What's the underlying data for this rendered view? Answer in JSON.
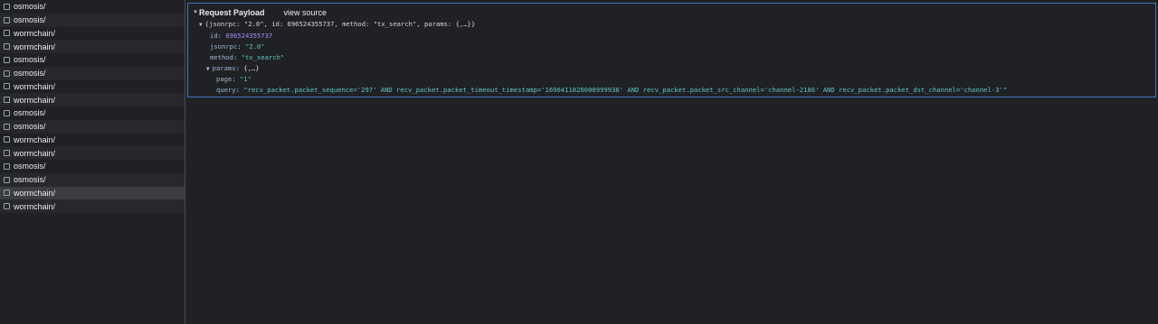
{
  "sidebar": {
    "items": [
      {
        "label": "osmosis/"
      },
      {
        "label": "osmosis/"
      },
      {
        "label": "wormchain/"
      },
      {
        "label": "wormchain/"
      },
      {
        "label": "osmosis/"
      },
      {
        "label": "osmosis/"
      },
      {
        "label": "wormchain/"
      },
      {
        "label": "wormchain/"
      },
      {
        "label": "osmosis/"
      },
      {
        "label": "osmosis/"
      },
      {
        "label": "wormchain/"
      },
      {
        "label": "wormchain/"
      },
      {
        "label": "osmosis/"
      },
      {
        "label": "osmosis/"
      },
      {
        "label": "wormchain/",
        "selected": true
      },
      {
        "label": "wormchain/"
      }
    ]
  },
  "payload": {
    "header": "Request Payload",
    "view_source": "view source",
    "summary": "{jsonrpc: \"2.0\", id: 696524355737, method: \"tx_search\", params: {,…}}",
    "fields": {
      "id_key": "id",
      "id_value": "696524355737",
      "jsonrpc_key": "jsonrpc",
      "jsonrpc_value": "\"2.0\"",
      "method_key": "method",
      "method_value": "\"tx_search\"",
      "params_key": "params",
      "params_value": "{,…}",
      "page_key": "page",
      "page_value": "\"1\"",
      "query_key": "query",
      "query_value": "\"recv_packet.packet_sequence='297' AND recv_packet.packet_timeout_timestamp='1696411826008999936' AND recv_packet.packet_src_channel='channel-2186' AND recv_packet.packet_dst_channel='channel-3'\""
    }
  },
  "colors": {
    "background": "#202124",
    "border_accent": "#3d7ab8",
    "string_value": "#5fc7c7",
    "number_value": "#a58dff"
  }
}
